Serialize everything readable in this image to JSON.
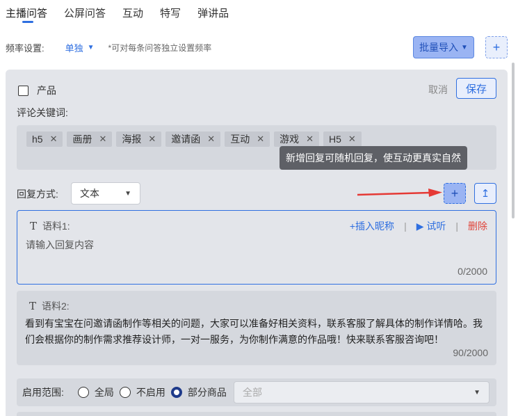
{
  "tabs": [
    "主播问答",
    "公屏问答",
    "互动",
    "特写",
    "弹讲品"
  ],
  "frequency": {
    "label": "频率设置:",
    "value": "单独",
    "note": "*可对每条问答独立设置频率"
  },
  "toolbar": {
    "import_label": "批量导入",
    "add_label": "+"
  },
  "editor": {
    "product_checkbox_label": "产品",
    "cancel_label": "取消",
    "save_label": "保存",
    "keywords_label": "评论关键词:",
    "keywords": [
      "h5",
      "画册",
      "海报",
      "邀请函",
      "互动",
      "游戏",
      "H5"
    ],
    "tooltip": "新增回复可随机回复，使互动更真实自然",
    "reply_method_label": "回复方式:",
    "reply_method_value": "文本",
    "add_corpus_label": "+",
    "upload_label": "↥",
    "corpus": [
      {
        "title": "语料1:",
        "placeholder": "请输入回复内容",
        "counter": "0/2000",
        "actions": {
          "insert_nickname": "+插入昵称",
          "listen": "▶ 试听",
          "delete": "删除"
        }
      },
      {
        "title": "语料2:",
        "content": "看到有宝宝在问邀请函制作等相关的问题，大家可以准备好相关资料，联系客服了解具体的制作详情哈。我们会根据你的制作需求推荐设计师，一对一服务，为你制作满意的作品哦！快来联系客服咨询吧！",
        "counter": "90/2000"
      }
    ],
    "scope": {
      "label": "启用范围:",
      "options": [
        "全局",
        "不启用",
        "部分商品"
      ],
      "selected": "部分商品",
      "select_placeholder": "全部"
    }
  },
  "colors": {
    "accent": "#2f6fe0",
    "danger": "#e0453a",
    "arrow": "#e53935"
  }
}
